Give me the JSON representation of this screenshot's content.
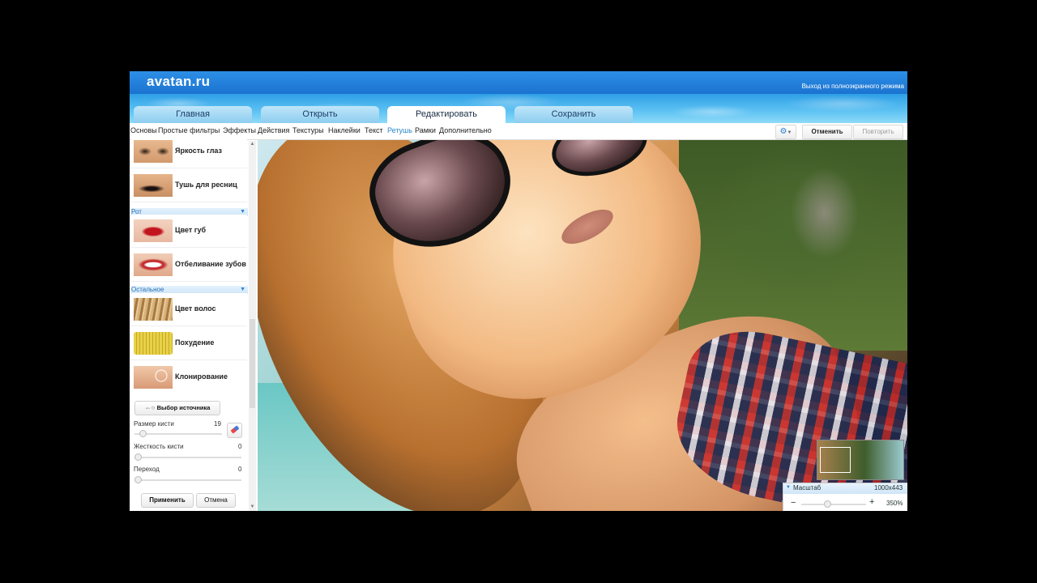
{
  "app": {
    "logo": "avatan.ru",
    "fullscreen_exit": "Выход из полноэкранного режима"
  },
  "tabs": [
    {
      "label": "Главная",
      "active": false
    },
    {
      "label": "Открыть",
      "active": false
    },
    {
      "label": "Редактировать",
      "active": true
    },
    {
      "label": "Сохранить",
      "active": false
    }
  ],
  "menu": [
    {
      "label": "Основы"
    },
    {
      "label": "Простые фильтры"
    },
    {
      "label": "Эффекты"
    },
    {
      "label": "Действия"
    },
    {
      "label": "Текстуры"
    },
    {
      "label": "Наклейки"
    },
    {
      "label": "Текст"
    },
    {
      "label": "Ретушь",
      "active": true
    },
    {
      "label": "Рамки"
    },
    {
      "label": "Дополнительно"
    }
  ],
  "toolbar": {
    "settings_icon": "gear-icon",
    "undo_label": "Отменить",
    "redo_label": "Повторить"
  },
  "panel": {
    "tools_top": [
      {
        "label": "Яркость глаз",
        "icon": "eye-thumb"
      },
      {
        "label": "Тушь для ресниц",
        "icon": "lashes-thumb"
      }
    ],
    "section_mouth": "Рот",
    "tools_mouth": [
      {
        "label": "Цвет губ",
        "icon": "lips-thumb"
      },
      {
        "label": "Отбеливание зубов",
        "icon": "teeth-thumb"
      }
    ],
    "section_other": "Остальное",
    "tools_other": [
      {
        "label": "Цвет волос",
        "icon": "hair-thumb"
      },
      {
        "label": "Похудение",
        "icon": "measuring-tape-thumb"
      },
      {
        "label": "Клонирование",
        "icon": "clone-thumb"
      }
    ],
    "source_button": "Выбор источника",
    "brush_size_label": "Размер кисти",
    "brush_size_value": "19",
    "hardness_label": "Жесткость кисти",
    "hardness_value": "0",
    "transition_label": "Переход",
    "transition_value": "0",
    "apply_label": "Применить",
    "cancel_label": "Отмена"
  },
  "zoom": {
    "label": "Масштаб",
    "dimensions": "1000x443",
    "minus": "−",
    "plus": "+",
    "percent": "350%"
  }
}
